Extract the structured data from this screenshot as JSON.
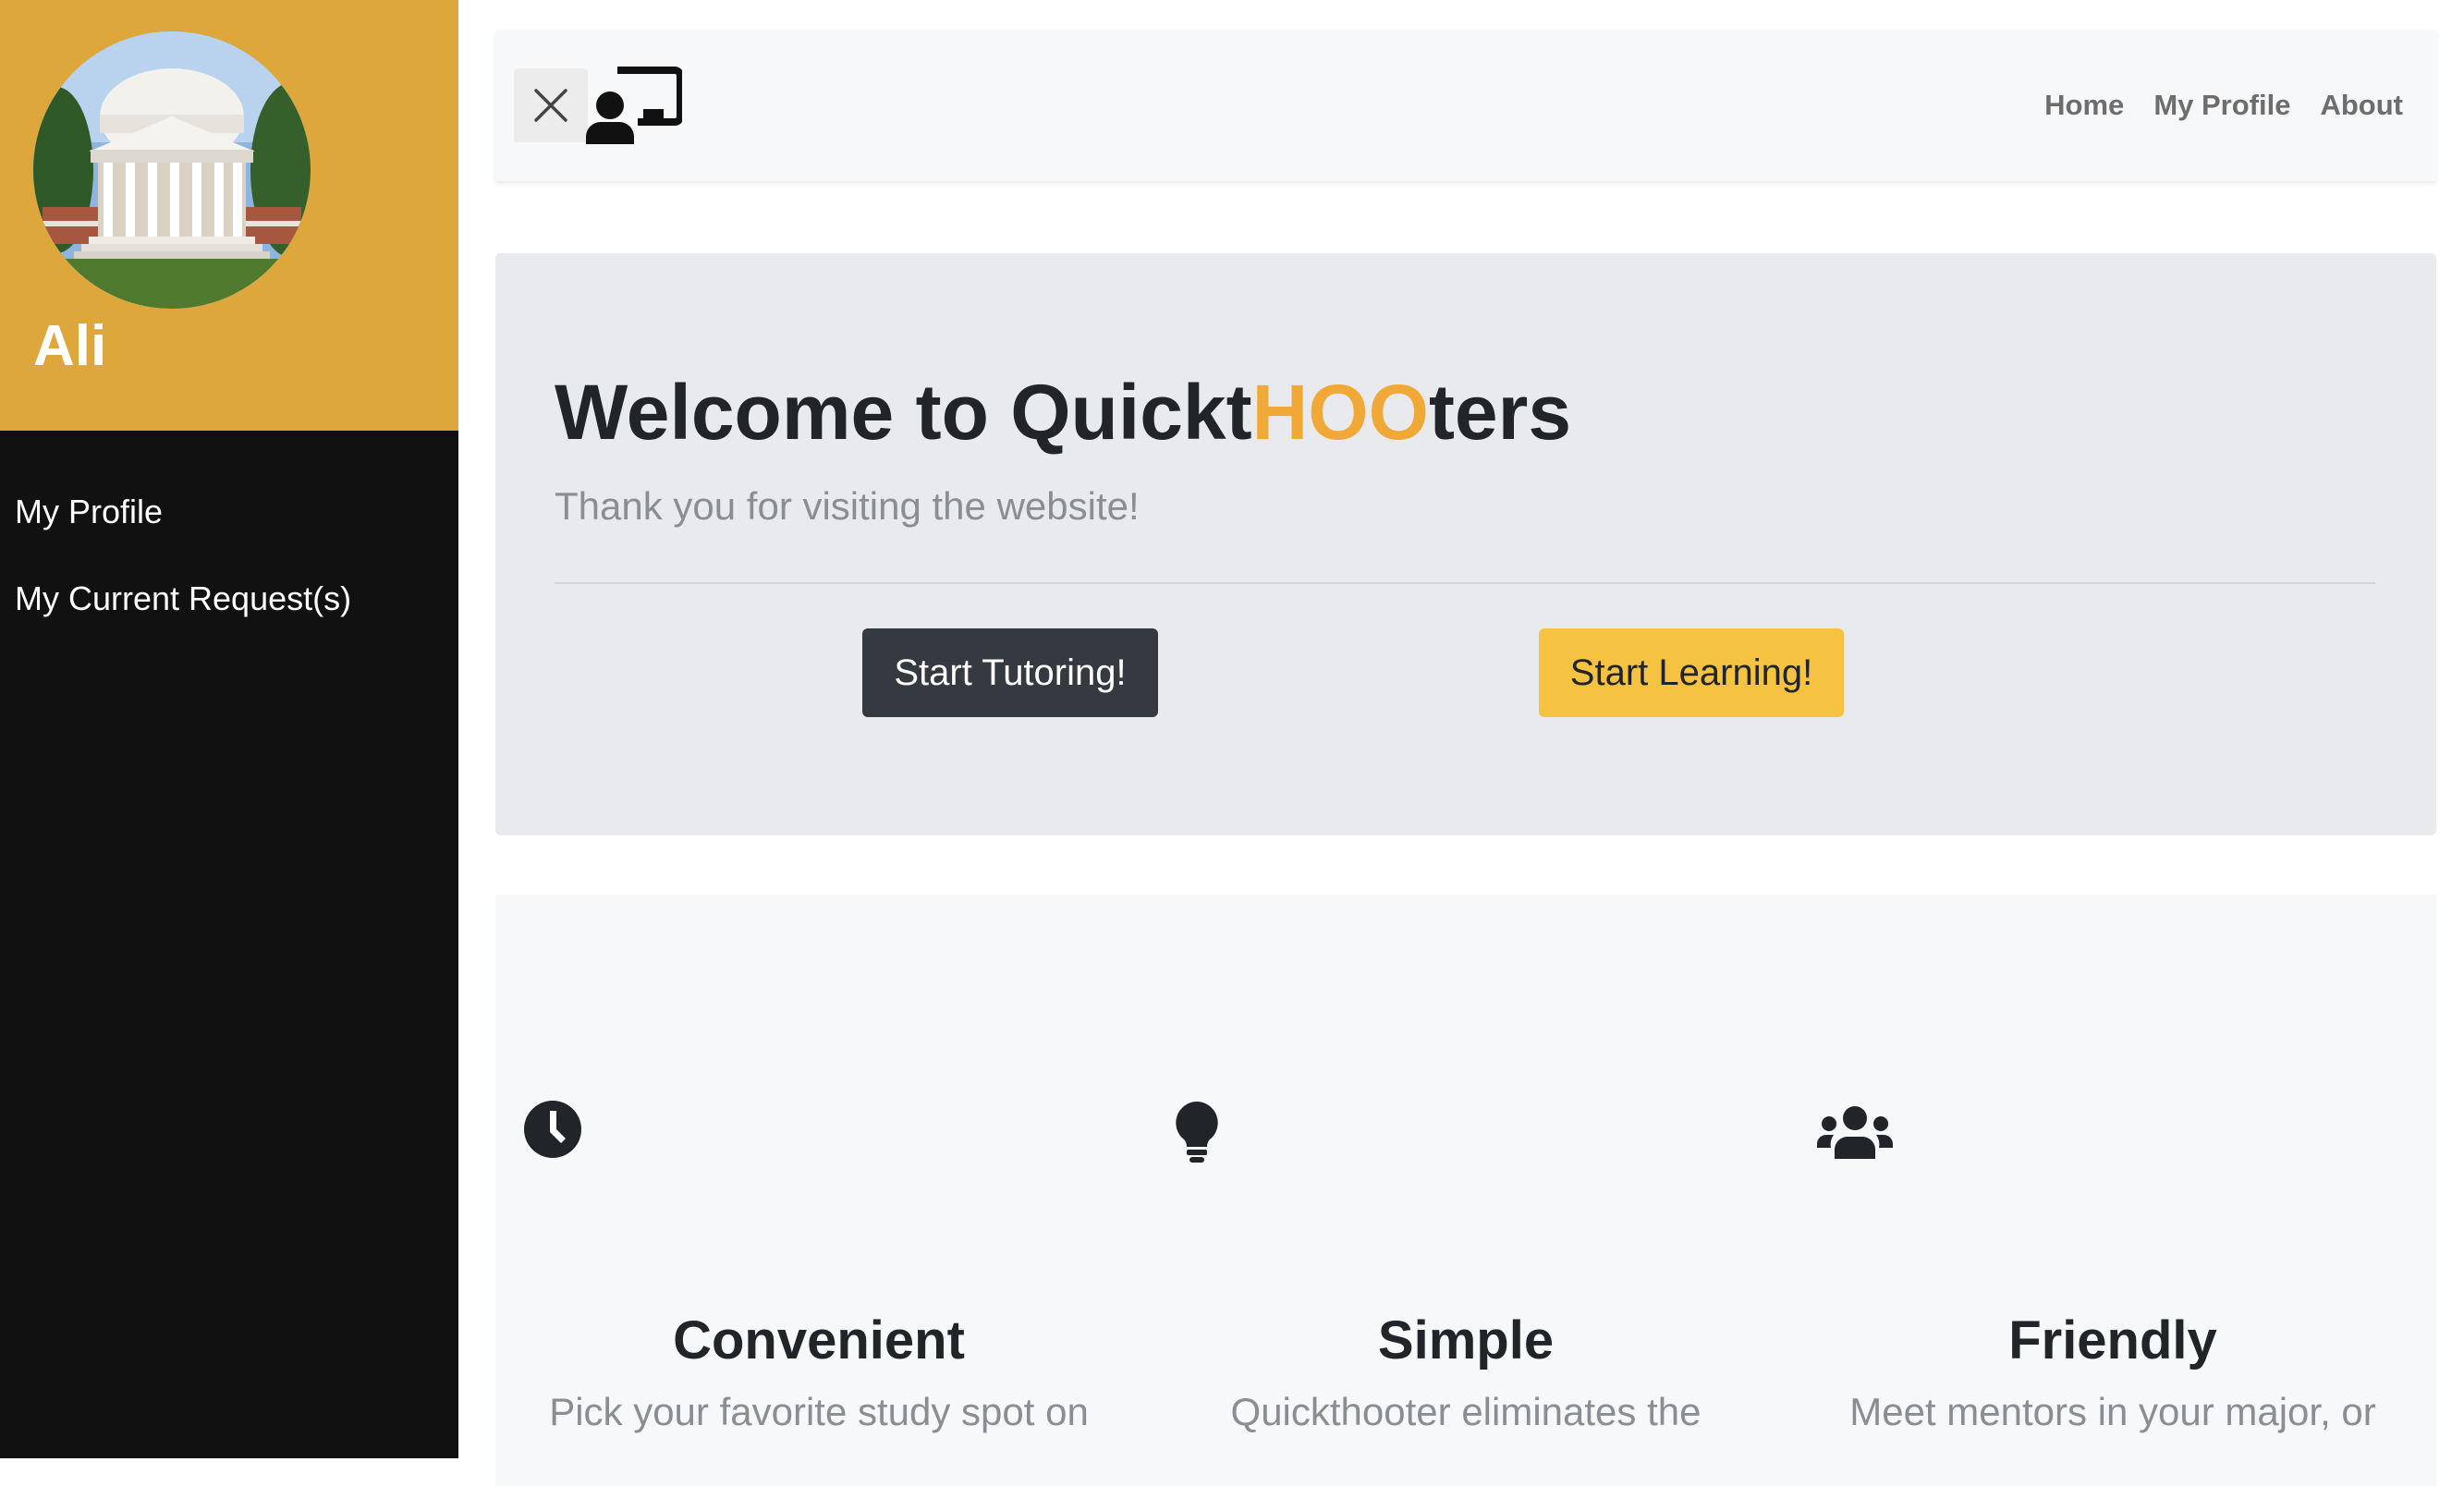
{
  "sidebar": {
    "user_name": "Ali",
    "avatar_icon": "rotunda-building-photo",
    "header_color": "#dea73b",
    "items": [
      {
        "label": "My Profile"
      },
      {
        "label": "My Current Request(s)"
      }
    ]
  },
  "navbar": {
    "close_icon": "close-icon",
    "logo_icon": "tutor-presentation-icon",
    "links": [
      {
        "label": "Home"
      },
      {
        "label": "My Profile"
      },
      {
        "label": "About"
      }
    ]
  },
  "hero": {
    "title_prefix": "Welcome to Quickt",
    "title_accent": "HOO",
    "title_suffix": "ters",
    "accent_color": "#f0a836",
    "subtitle": "Thank you for visiting the website!",
    "buttons": {
      "tutor": "Start Tutoring!",
      "learn": "Start Learning!"
    }
  },
  "features": [
    {
      "icon": "clock-icon",
      "title": "Convenient",
      "text": "Pick your favorite study spot on"
    },
    {
      "icon": "lightbulb-icon",
      "title": "Simple",
      "text": "Quickthooter eliminates the"
    },
    {
      "icon": "users-icon",
      "title": "Friendly",
      "text": "Meet mentors in your major, or"
    }
  ]
}
